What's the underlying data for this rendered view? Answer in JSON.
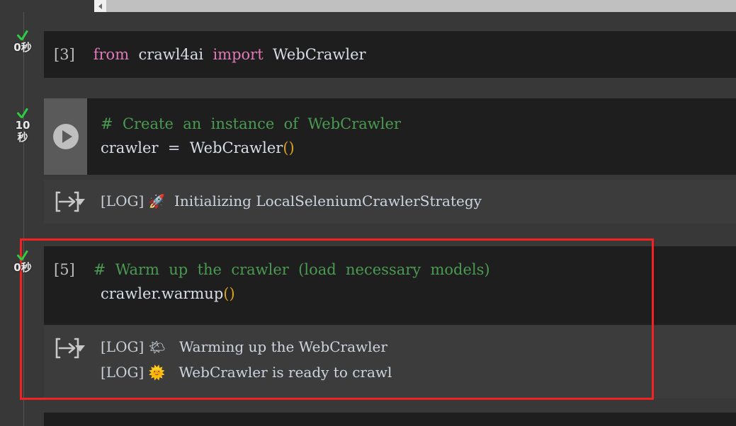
{
  "scrollbar": {
    "left_arrow_icon": "chevron-left-icon"
  },
  "cells": [
    {
      "id": "cell-3",
      "prompt": "[3]",
      "exec_check_icon": "green-check-icon",
      "exec_time": "0秒",
      "code_tokens": [
        {
          "t": "from",
          "c": "kw"
        },
        {
          "t": "  ",
          "c": "plain"
        },
        {
          "t": "crawl4ai",
          "c": "ident"
        },
        {
          "t": "  ",
          "c": "plain"
        },
        {
          "t": "import",
          "c": "kw"
        },
        {
          "t": "  ",
          "c": "plain"
        },
        {
          "t": "WebCrawler",
          "c": "ident"
        }
      ],
      "has_run_button": false,
      "output": null
    },
    {
      "id": "cell-create-instance",
      "prompt": "",
      "exec_check_icon": "green-check-icon",
      "exec_time": "10\n秒",
      "run_button_icon": "play-circle-icon",
      "has_run_button": true,
      "code_lines": [
        [
          {
            "t": "#  Create  an  instance  of  WebCrawler",
            "c": "comment"
          }
        ],
        [
          {
            "t": "crawler  =  WebCrawler",
            "c": "plain"
          },
          {
            "t": "()",
            "c": "paren"
          }
        ]
      ],
      "output": {
        "icon": "output-collapse-icon",
        "lines": [
          {
            "tag": "[LOG]",
            "emoji": "🚀",
            "text": "Initializing LocalSeleniumCrawlerStrategy"
          }
        ]
      }
    },
    {
      "id": "cell-5",
      "prompt": "[5]",
      "exec_check_icon": "green-check-icon",
      "exec_time": "0秒",
      "has_run_button": false,
      "code_lines": [
        [
          {
            "t": "#  Warm  up  the  crawler  (load  necessary  models)",
            "c": "comment"
          }
        ],
        [
          {
            "t": "crawler.warmup",
            "c": "plain"
          },
          {
            "t": "()",
            "c": "paren"
          }
        ]
      ],
      "output": {
        "icon": "output-collapse-icon",
        "lines": [
          {
            "tag": "[LOG]",
            "emoji": "🌤",
            "text": " Warming up the WebCrawler"
          },
          {
            "tag": "[LOG]",
            "emoji": "🌞",
            "text": " WebCrawler is ready to crawl"
          }
        ]
      },
      "highlighted": true
    }
  ],
  "annotation": {
    "color": "#f42222",
    "target": "cell-5"
  },
  "colors": {
    "cell_background": "#1e1e1e",
    "output_background": "#3c3c3c",
    "page_background": "#383838",
    "run_panel": "#5a5a5a",
    "check_green": "#2ecc40",
    "comment_green": "#4a9a52",
    "keyword_pink": "#e07ab8",
    "paren_orange": "#d8a020"
  }
}
